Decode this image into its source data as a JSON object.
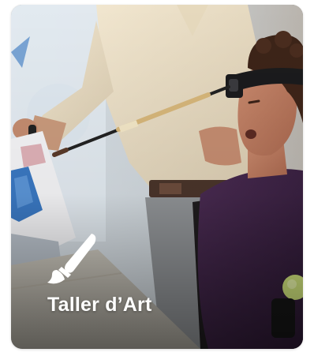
{
  "card": {
    "title": "Taller d’Art",
    "icon": "paintbrush-icon",
    "photo": "person-using-head-mounted-paintbrush"
  },
  "colors": {
    "title_text": "#ffffff",
    "icon_fill": "#ffffff"
  }
}
